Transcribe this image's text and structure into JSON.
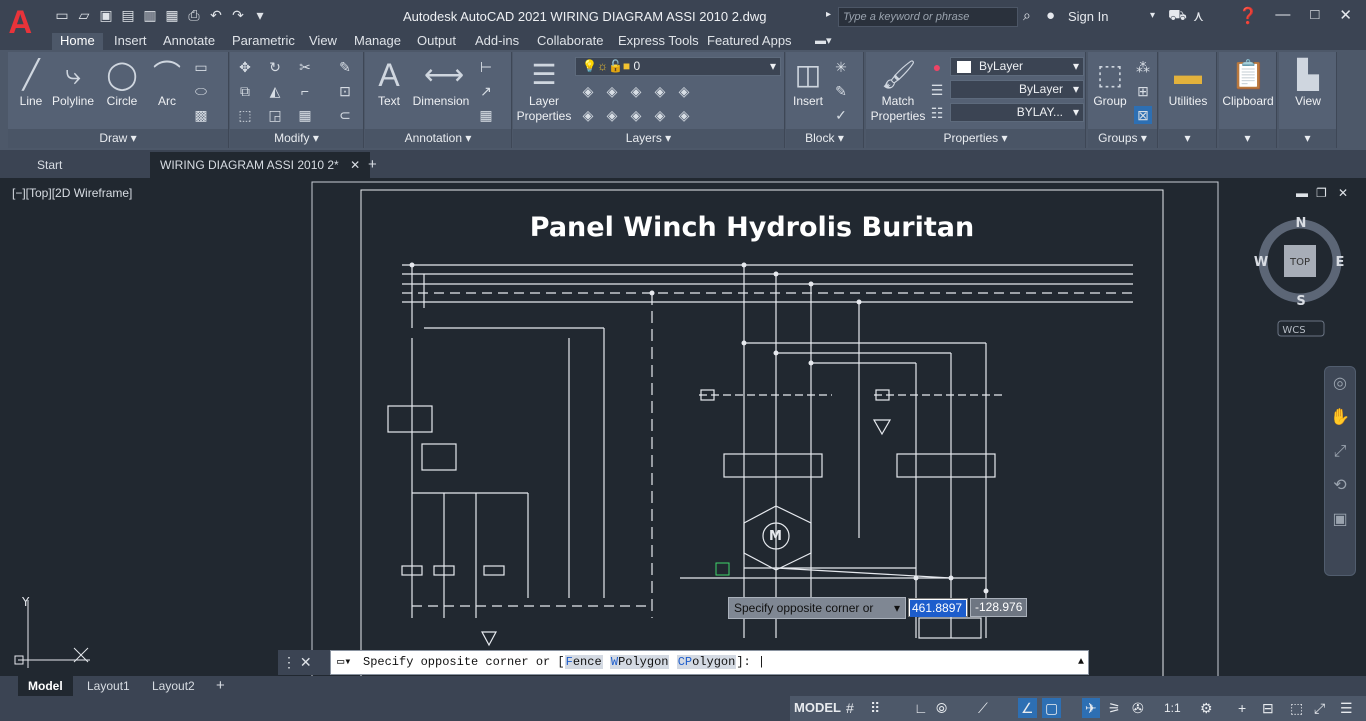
{
  "app": {
    "logo": "A",
    "title": "Autodesk AutoCAD 2021    WIRING DIAGRAM ASSI 2010 2.dwg",
    "search_placeholder": "Type a keyword or phrase",
    "sign_in": "Sign In"
  },
  "menu": [
    "Home",
    "Insert",
    "Annotate",
    "Parametric",
    "View",
    "Manage",
    "Output",
    "Add-ins",
    "Collaborate",
    "Express Tools",
    "Featured Apps"
  ],
  "ribbon": {
    "draw": {
      "title": "Draw",
      "tools": [
        "Line",
        "Polyline",
        "Circle",
        "Arc"
      ]
    },
    "modify": {
      "title": "Modify"
    },
    "annotation": {
      "title": "Annotation",
      "text": "Text",
      "dimension": "Dimension"
    },
    "layers": {
      "title": "Layers",
      "layer_props_1": "Layer",
      "layer_props_2": "Properties",
      "current_layer": "0"
    },
    "block": {
      "title": "Block",
      "insert": "Insert"
    },
    "properties": {
      "title": "Properties",
      "match_1": "Match",
      "match_2": "Properties",
      "color": "ByLayer",
      "linetype": "ByLayer",
      "lineweight": "BYLAY..."
    },
    "groups": {
      "title": "Groups",
      "group": "Group"
    },
    "utilities": "Utilities",
    "clipboard": "Clipboard",
    "view": "View"
  },
  "doc_tabs": {
    "start": "Start",
    "current": "WIRING DIAGRAM ASSI 2010 2*",
    "add": "+"
  },
  "viewport": {
    "label": "[−][Top][2D Wireframe]",
    "drawing_title": "Panel Winch Hydrolis Buritan",
    "viewcube": {
      "n": "N",
      "s": "S",
      "e": "E",
      "w": "W",
      "top": "TOP",
      "wcs": "WCS"
    },
    "ucs_y": "Y"
  },
  "prompt": {
    "tooltip": "Specify opposite corner or",
    "x_value": "461.8897",
    "y_value": "-128.976"
  },
  "command": {
    "text_prefix": "Specify opposite corner or [",
    "opt1_a": "F",
    "opt1_b": "ence",
    "opt2_a": "W",
    "opt2_b": "Polygon",
    "opt3_a": "CP",
    "opt3_b": "olygon",
    "text_suffix": "]: "
  },
  "layout_tabs": [
    "Model",
    "Layout1",
    "Layout2"
  ],
  "status": {
    "model": "MODEL",
    "scale": "1:1"
  },
  "colors": {
    "accent": "#1d5dcc",
    "logo": "#e8333a",
    "title_text": "#ffffff"
  }
}
